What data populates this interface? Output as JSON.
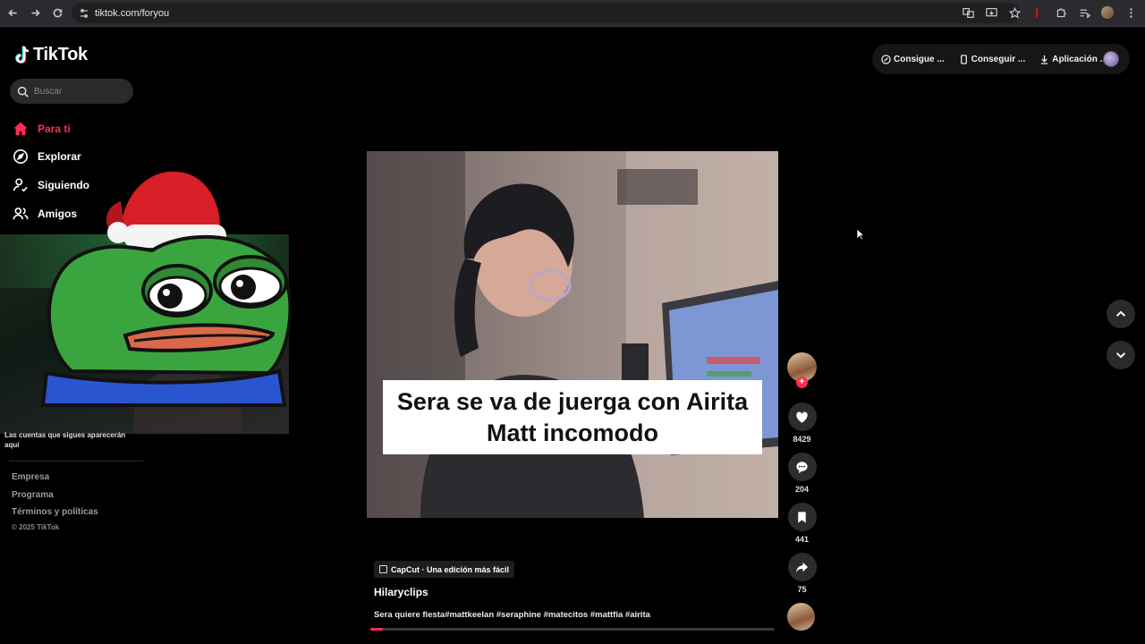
{
  "browser": {
    "url": "tiktok.com/foryou"
  },
  "brand": {
    "name": "TikTok"
  },
  "search": {
    "placeholder": "Buscar"
  },
  "sidebar": {
    "items": [
      {
        "label": "Para ti",
        "icon": "home-icon",
        "active": true
      },
      {
        "label": "Explorar",
        "icon": "compass-icon",
        "active": false
      },
      {
        "label": "Siguiendo",
        "icon": "user-follow-icon",
        "active": false
      },
      {
        "label": "Amigos",
        "icon": "friends-icon",
        "active": false
      }
    ],
    "following_hint": "Las cuentas que sigues aparecerán aquí",
    "footer_links": [
      "Empresa",
      "Programa",
      "Términos y políticas"
    ],
    "copyright": "© 2025 TikTok"
  },
  "top_bar": {
    "buttons": [
      {
        "label": "Consigue ...",
        "icon": "coin-icon"
      },
      {
        "label": "Conseguir ...",
        "icon": "phone-icon"
      },
      {
        "label": "Aplicación ...",
        "icon": "download-icon"
      }
    ]
  },
  "video": {
    "caption_line1": "Sera se va de juerga con Airita",
    "caption_line2": "Matt incomodo",
    "capcut_label": "CapCut · Una edición más fácil",
    "author": "Hilaryclips",
    "description": "Sera quiere fiesta#mattkeelan #seraphine #matecitos #mattfia #airita",
    "progress": 0.03
  },
  "actions": {
    "likes": "8429",
    "comments": "204",
    "saves": "441",
    "shares": "75"
  },
  "colors": {
    "accent": "#fe2c55",
    "background": "#000000"
  }
}
